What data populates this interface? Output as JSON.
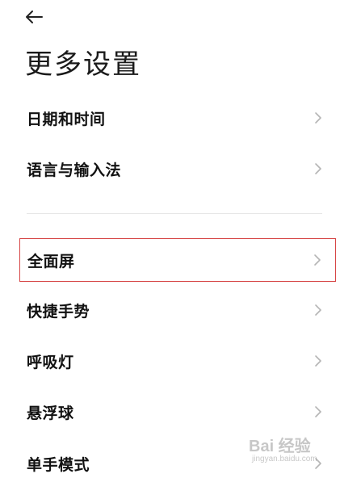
{
  "header": {
    "back_icon": "back-arrow-icon",
    "title": "更多设置"
  },
  "settings_group_1": [
    {
      "label": "日期和时间",
      "icon": "chevron-right-icon"
    },
    {
      "label": "语言与输入法",
      "icon": "chevron-right-icon"
    }
  ],
  "settings_group_2": [
    {
      "label": "全面屏",
      "icon": "chevron-right-icon",
      "highlighted": true
    },
    {
      "label": "快捷手势",
      "icon": "chevron-right-icon"
    },
    {
      "label": "呼吸灯",
      "icon": "chevron-right-icon"
    },
    {
      "label": "悬浮球",
      "icon": "chevron-right-icon"
    },
    {
      "label": "单手模式",
      "icon": "chevron-right-icon"
    }
  ],
  "watermark": {
    "text": "Bai 经验",
    "sub": "jingyan.baidu.com"
  },
  "colors": {
    "highlight_border": "#d64545",
    "chevron": "#b5b5b5",
    "divider": "#e7e7e7"
  }
}
